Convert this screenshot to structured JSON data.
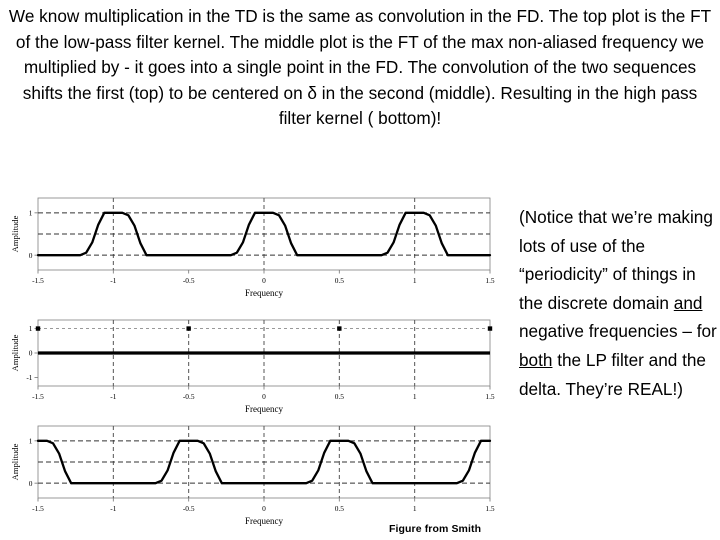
{
  "slide": {
    "header_paragraph": "We know multiplication in the TD is the same as convolution in the FD. The top plot is the FT of the low-pass filter kernel. The middle plot is the FT of the max non-aliased frequency we multiplied by - it goes into a single point in the FD. The convolution of the two sequences shifts the first (top) to be centered on δ in the second (middle). Resulting in the high pass filter kernel ( bottom)!",
    "side_note": {
      "part1": "(Notice that we’re making lots of use of the “periodicity” of things in the discrete domain ",
      "underline1": "and",
      "part2": " negative frequencies – for ",
      "underline2": "both",
      "part3": " the LP filter and the delta. They’re REAL!)"
    },
    "figure_credit": "Figure from Smith",
    "colors": {
      "ink": "#000000",
      "background": "#ffffff",
      "grid": "#808080",
      "axis": "#808080"
    }
  },
  "chart_data": [
    {
      "id": "top",
      "type": "line",
      "title": "",
      "xlabel": "Frequency",
      "ylabel": "Amplitude",
      "xlim": [
        -1.5,
        1.5
      ],
      "ylim": [
        -0.35,
        1.35
      ],
      "xticks": [
        -1.5,
        -1,
        -0.5,
        0,
        0.5,
        1,
        1.5
      ],
      "xticklabels": [
        "-1.5",
        "-1",
        "-0.5",
        "0",
        "0.5",
        "1",
        "1.5"
      ],
      "yticks": [
        0,
        1
      ],
      "yticklabels": [
        "0",
        "1"
      ],
      "gridlines_y": [
        0,
        0.5,
        1
      ],
      "gridlines_x": [
        -1,
        0,
        1
      ],
      "grid": true,
      "description": "FT of low-pass filter kernel: periodic rectangular passbands centered at -1, 0 and 1",
      "x": [
        -1.5,
        -1.22,
        -1.18,
        -1.14,
        -1.1,
        -1.06,
        -0.94,
        -0.9,
        -0.86,
        -0.82,
        -0.78,
        -0.22,
        -0.18,
        -0.14,
        -0.1,
        -0.06,
        0.06,
        0.1,
        0.14,
        0.18,
        0.22,
        0.78,
        0.82,
        0.86,
        0.9,
        0.94,
        1.06,
        1.1,
        1.14,
        1.18,
        1.22,
        1.5
      ],
      "y": [
        0,
        0,
        0.06,
        0.3,
        0.72,
        1,
        1,
        0.94,
        0.7,
        0.28,
        0,
        0,
        0.06,
        0.3,
        0.72,
        1,
        1,
        0.94,
        0.7,
        0.28,
        0,
        0,
        0.06,
        0.3,
        0.72,
        1,
        1,
        0.94,
        0.7,
        0.28,
        0,
        0
      ]
    },
    {
      "id": "middle",
      "type": "scatter",
      "title": "",
      "xlabel": "Frequency",
      "ylabel": "Amplitude",
      "xlim": [
        -1.5,
        1.5
      ],
      "ylim": [
        -1.35,
        1.35
      ],
      "xticks": [
        -1.5,
        -1,
        -0.5,
        0,
        0.5,
        1,
        1.5
      ],
      "xticklabels": [
        "-1.5",
        "-1",
        "-0.5",
        "0",
        "0.5",
        "1",
        "1.5"
      ],
      "yticks": [
        -1,
        0,
        1
      ],
      "yticklabels": [
        "-1",
        "0",
        "1"
      ],
      "gridlines_y": [
        1
      ],
      "gridlines_x": [
        -1,
        -0.5,
        0,
        0.5,
        1
      ],
      "grid": true,
      "description": "FT of max non-aliased frequency: unit impulses at -1.5, -0.5, 0.5, 1.5 on a zero baseline",
      "impulse_x": [
        -1.5,
        -0.5,
        0.5,
        1.5
      ],
      "impulse_y": [
        1,
        1,
        1,
        1
      ],
      "baseline": 0
    },
    {
      "id": "bottom",
      "type": "line",
      "title": "",
      "xlabel": "Frequency",
      "ylabel": "Amplitude",
      "xlim": [
        -1.5,
        1.5
      ],
      "ylim": [
        -0.35,
        1.35
      ],
      "xticks": [
        -1.5,
        -1,
        -0.5,
        0,
        0.5,
        1,
        1.5
      ],
      "xticklabels": [
        "-1.5",
        "-1",
        "-0.5",
        "0",
        "0.5",
        "1",
        "1.5"
      ],
      "yticks": [
        0,
        1
      ],
      "yticklabels": [
        "0",
        "1"
      ],
      "gridlines_y": [
        0,
        0.5,
        1
      ],
      "gridlines_x": [
        -1,
        -0.5,
        0,
        0.5,
        1
      ],
      "grid": true,
      "description": "Resulting high-pass filter kernel FT: passbands centered at -1.5, -0.5, 0.5 and 1.5",
      "x": [
        -1.5,
        -1.44,
        -1.4,
        -1.36,
        -1.32,
        -1.28,
        -0.72,
        -0.68,
        -0.64,
        -0.6,
        -0.56,
        -0.44,
        -0.4,
        -0.36,
        -0.32,
        -0.28,
        0.28,
        0.32,
        0.36,
        0.4,
        0.44,
        0.56,
        0.6,
        0.64,
        0.68,
        0.72,
        1.28,
        1.32,
        1.36,
        1.4,
        1.44,
        1.5
      ],
      "y": [
        1,
        1,
        0.94,
        0.7,
        0.28,
        0,
        0,
        0.06,
        0.3,
        0.72,
        1,
        1,
        0.94,
        0.7,
        0.28,
        0,
        0,
        0.06,
        0.3,
        0.72,
        1,
        1,
        0.94,
        0.7,
        0.28,
        0,
        0,
        0.06,
        0.3,
        0.72,
        1,
        1
      ]
    }
  ]
}
